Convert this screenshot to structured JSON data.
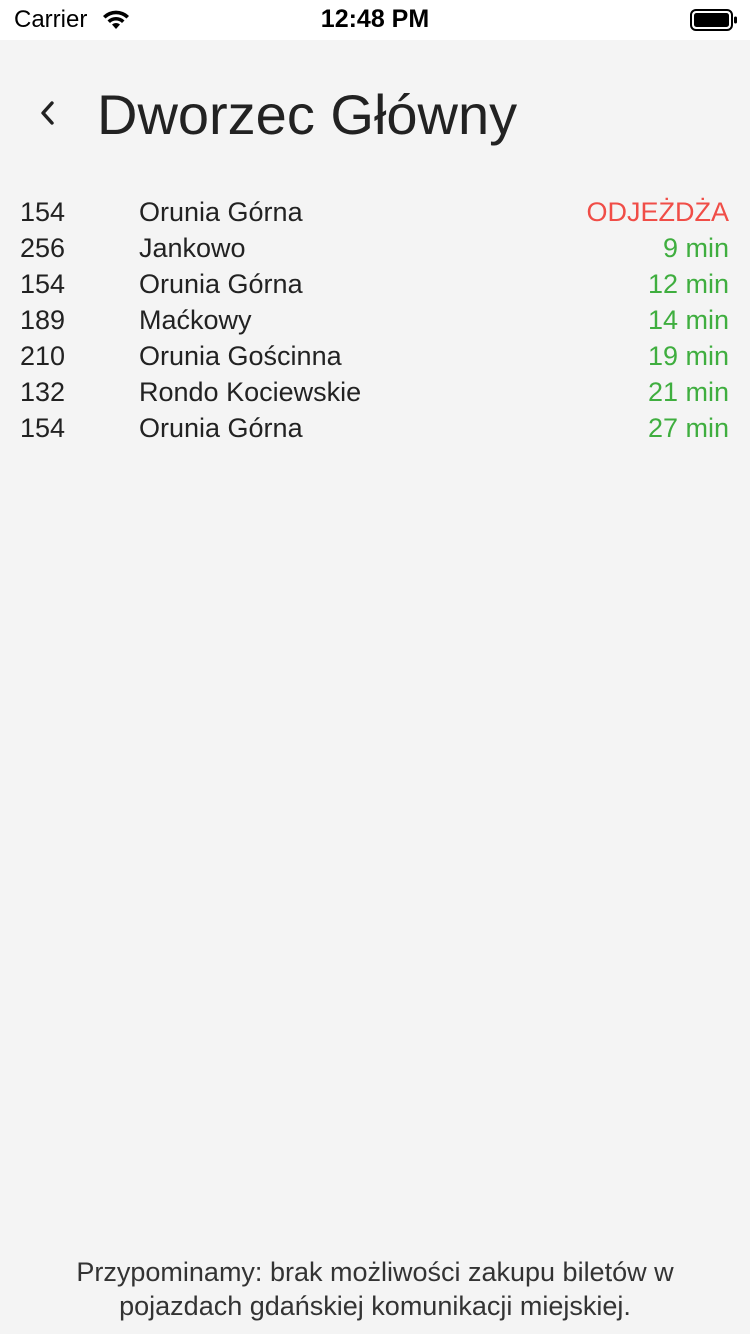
{
  "status_bar": {
    "carrier": "Carrier",
    "time": "12:48 PM",
    "icons": [
      "wifi-icon",
      "battery-icon"
    ]
  },
  "header": {
    "back_icon": "chevron-left-icon",
    "title": "Dworzec Główny"
  },
  "departures": [
    {
      "line": "154",
      "destination": "Orunia Górna",
      "time": "ODJEŻDŻA",
      "status": "leaving"
    },
    {
      "line": "256",
      "destination": "Jankowo",
      "time": "9 min",
      "status": "upcoming"
    },
    {
      "line": "154",
      "destination": "Orunia Górna",
      "time": "12 min",
      "status": "upcoming"
    },
    {
      "line": "189",
      "destination": "Maćkowy",
      "time": "14 min",
      "status": "upcoming"
    },
    {
      "line": "210",
      "destination": "Orunia Gościnna",
      "time": "19 min",
      "status": "upcoming"
    },
    {
      "line": "132",
      "destination": "Rondo Kociewskie",
      "time": "21 min",
      "status": "upcoming"
    },
    {
      "line": "154",
      "destination": "Orunia Górna",
      "time": "27 min",
      "status": "upcoming"
    }
  ],
  "footer": {
    "note": "Przypominamy: brak możliwości zakupu biletów w pojazdach gdańskiej komunikacji miejskiej."
  },
  "colors": {
    "leaving": "#f04d47",
    "upcoming": "#3fae3f",
    "background": "#f4f4f4"
  }
}
